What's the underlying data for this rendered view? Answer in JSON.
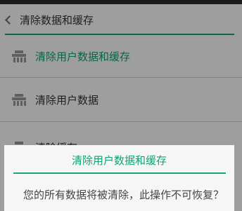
{
  "header": {
    "title": "清除数据和缓存"
  },
  "list": {
    "items": [
      {
        "label": "清除用户数据和缓存",
        "icon": "clean-brush-icon",
        "selected": true
      },
      {
        "label": "清除用户数据",
        "icon": "clean-brush-icon",
        "selected": false
      },
      {
        "label": "清除缓存",
        "icon": "clean-brush-icon",
        "selected": false
      }
    ]
  },
  "dialog": {
    "title": "清除用户数据和缓存",
    "message": "您的所有数据将被清除，此操作不可恢复？"
  },
  "colors": {
    "accent": "#13a26f",
    "header_rule": "#14a37a"
  }
}
